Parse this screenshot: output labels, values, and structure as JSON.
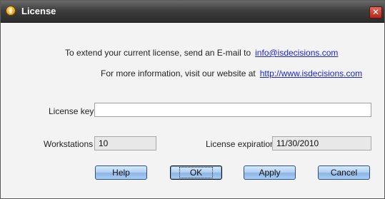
{
  "window": {
    "title": "License",
    "close_glyph": "✕"
  },
  "info": {
    "email_text": "To extend your current license, send an E-mail to",
    "email_link": "info@isdecisions.com",
    "web_text": "For more information, visit our website at",
    "web_link": "http://www.isdecisions.com"
  },
  "fields": {
    "license_key_label": "License key",
    "license_key_value": "",
    "workstations_label": "Workstations",
    "workstations_value": "10",
    "expiration_label": "License expiration",
    "expiration_value": "11/30/2010"
  },
  "buttons": {
    "help": "Help",
    "ok": "OK",
    "apply": "Apply",
    "cancel": "Cancel"
  },
  "colors": {
    "link": "#1a25d6",
    "titlebar": "#3e3e3e",
    "button": "#b3d1f3"
  }
}
